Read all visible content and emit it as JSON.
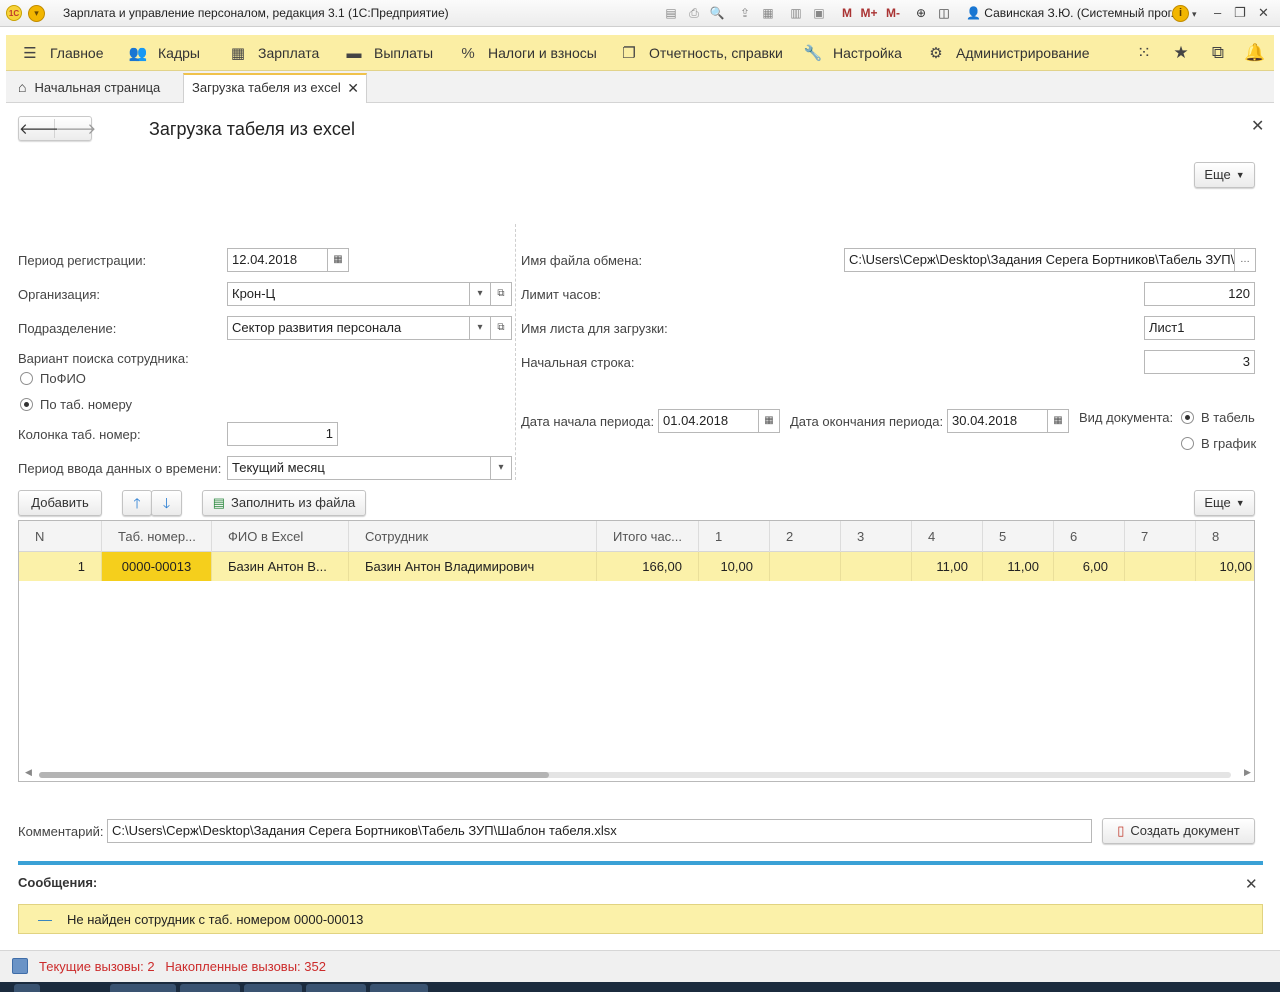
{
  "window": {
    "title": "Зарплата и управление персоналом, редакция 3.1  (1С:Предприятие)",
    "user": "Савинская З.Ю. (Системный прог...",
    "m_labels": [
      "M",
      "M+",
      "M-"
    ]
  },
  "mainmenu": {
    "items": [
      {
        "label": "Главное",
        "icon": "menu-icon"
      },
      {
        "label": "Кадры",
        "icon": "people-icon"
      },
      {
        "label": "Зарплата",
        "icon": "calculator-icon"
      },
      {
        "label": "Выплаты",
        "icon": "wallet-icon"
      },
      {
        "label": "Налоги и взносы",
        "icon": "percent-icon"
      },
      {
        "label": "Отчетность, справки",
        "icon": "reports-icon"
      },
      {
        "label": "Настройка",
        "icon": "wrench-icon"
      },
      {
        "label": "Администрирование",
        "icon": "gear-icon"
      }
    ]
  },
  "tabs": {
    "home": "Начальная страница",
    "active": "Загрузка табеля из excel"
  },
  "form": {
    "title": "Загрузка табеля из excel",
    "more_label": "Еще",
    "left": {
      "period_label": "Период регистрации:",
      "period_value": "12.04.2018",
      "org_label": "Организация:",
      "org_value": "Крон-Ц",
      "dept_label": "Подразделение:",
      "dept_value": "Сектор развития персонала",
      "search_label": "Вариант поиска сотрудника:",
      "search_options": [
        "ПоФИО",
        "По таб. номеру"
      ],
      "search_selected": 1,
      "column_label": "Колонка таб. номер:",
      "column_value": "1",
      "input_period_label": "Период ввода данных о времени:",
      "input_period_value": "Текущий месяц"
    },
    "right": {
      "file_label": "Имя файла обмена:",
      "file_value": "C:\\Users\\Серж\\Desktop\\Задания Серега Бортников\\Табель ЗУП\\",
      "hours_label": "Лимит часов:",
      "hours_value": "120",
      "sheet_label": "Имя листа для загрузки:",
      "sheet_value": "Лист1",
      "row_label": "Начальная строка:",
      "row_value": "3",
      "start_label": "Дата начала периода:",
      "start_value": "01.04.2018",
      "end_label": "Дата окончания периода:",
      "end_value": "30.04.2018",
      "doctype_label": "Вид документа:",
      "doctype_options": [
        "В табель",
        "В график"
      ],
      "doctype_selected": 0
    },
    "toolbar": {
      "add_label": "Добавить",
      "fill_label": "Заполнить из файла",
      "more_label": "Еще"
    },
    "table": {
      "columns": [
        "N",
        "Таб. номер...",
        "ФИО в Excel",
        "Сотрудник",
        "Итого час...",
        "1",
        "2",
        "3",
        "4",
        "5",
        "6",
        "7",
        "8"
      ],
      "rows": [
        {
          "n": "1",
          "tab": "0000-00013",
          "fio_excel": "Базин Антон В...",
          "employee": "Базин Антон Владимирович",
          "total": "166,00",
          "days": [
            "10,00",
            "",
            "",
            "11,00",
            "11,00",
            "6,00",
            "",
            "10,00"
          ]
        }
      ]
    },
    "comment_label": "Комментарий:",
    "comment_value": "C:\\Users\\Серж\\Desktop\\Задания Серега Бортников\\Табель ЗУП\\Шаблон табеля.xlsx",
    "create_label": "Создать документ"
  },
  "messages": {
    "title": "Сообщения:",
    "items": [
      "Не найден сотрудник с таб. номером 0000-00013"
    ]
  },
  "status": {
    "current_calls": "Текущие вызовы: 2",
    "accum_calls": "Накопленные вызовы: 352"
  }
}
